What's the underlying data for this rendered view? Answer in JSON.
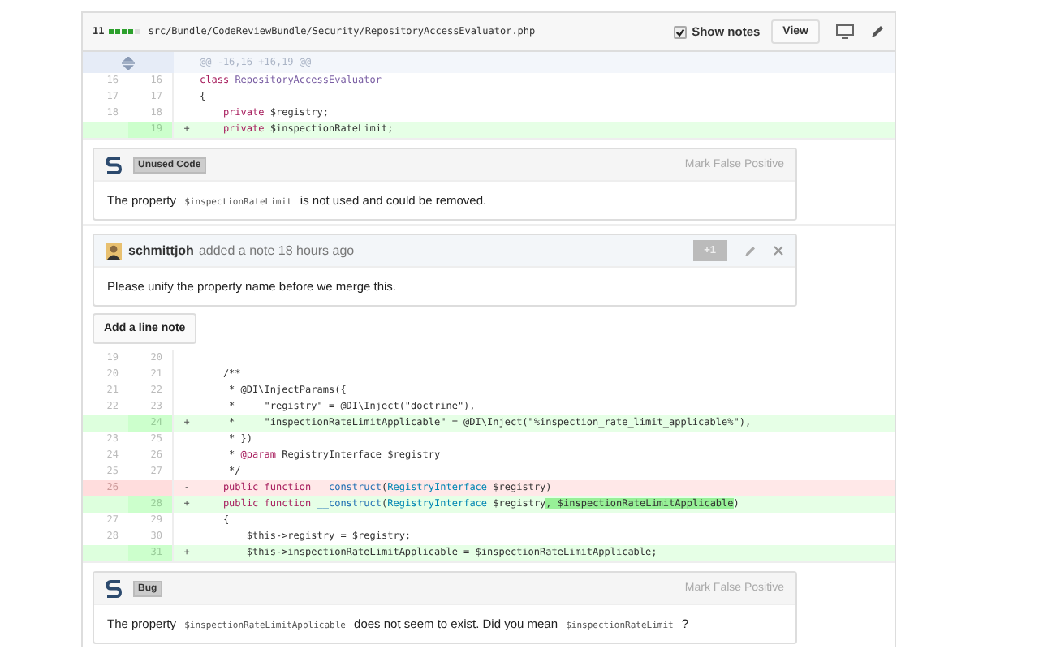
{
  "file": {
    "changes": "11",
    "diffstat": [
      true,
      true,
      true,
      true,
      false
    ],
    "path": "src/Bundle/CodeReviewBundle/Security/RepositoryAccessEvaluator.php",
    "show_notes": {
      "label": "Show notes",
      "checked": true
    },
    "view_button": "View"
  },
  "blocks": [
    {
      "kind": "hunk",
      "text": "@@ -16,16 +16,19 @@"
    },
    {
      "kind": "context",
      "old": "16",
      "new": "16",
      "code": [
        {
          "kind": "keyword",
          "text": "class "
        },
        {
          "kind": "class",
          "text": "RepositoryAccessEvaluator"
        }
      ]
    },
    {
      "kind": "context",
      "old": "17",
      "new": "17",
      "code": [
        {
          "kind": "plain",
          "text": "{"
        }
      ]
    },
    {
      "kind": "context",
      "old": "18",
      "new": "18",
      "code": [
        {
          "kind": "keyword",
          "text": "    private "
        },
        {
          "kind": "plain",
          "text": "$registry;"
        }
      ]
    },
    {
      "kind": "added",
      "new": "19",
      "sign": "+",
      "code": [
        {
          "kind": "keyword",
          "text": "    private "
        },
        {
          "kind": "plain",
          "text": "$inspectionRateLimit;"
        }
      ]
    },
    {
      "kind": "issue",
      "tag": "Unused Code",
      "action": "Mark False Positive",
      "message": [
        {
          "kind": "text",
          "text": "The property "
        },
        {
          "kind": "code",
          "text": "$inspectionRateLimit"
        },
        {
          "kind": "text",
          "text": " is not used and could be removed."
        }
      ]
    },
    {
      "kind": "note",
      "author": "schmittjoh",
      "meta": "added a note 18 hours ago",
      "vote": "+1",
      "body": "Please unify the property name before we merge this."
    },
    {
      "kind": "add-note",
      "label": "Add a line note"
    },
    {
      "kind": "context",
      "old": "19",
      "new": "20"
    },
    {
      "kind": "context",
      "old": "20",
      "new": "21",
      "code": [
        {
          "kind": "plain",
          "text": "    /**"
        }
      ]
    },
    {
      "kind": "context",
      "old": "21",
      "new": "22",
      "code": [
        {
          "kind": "plain",
          "text": "     * @DI\\InjectParams({"
        }
      ]
    },
    {
      "kind": "context",
      "old": "22",
      "new": "23",
      "code": [
        {
          "kind": "plain",
          "text": "     *     \"registry\" = @DI\\Inject(\"doctrine\"),"
        }
      ]
    },
    {
      "kind": "added",
      "new": "24",
      "sign": "+",
      "code": [
        {
          "kind": "plain",
          "text": "     *     \"inspectionRateLimitApplicable\" = @DI\\Inject(\"%inspection_rate_limit_applicable%\"),"
        }
      ]
    },
    {
      "kind": "context",
      "old": "23",
      "new": "25",
      "code": [
        {
          "kind": "plain",
          "text": "     * })"
        }
      ]
    },
    {
      "kind": "context",
      "old": "24",
      "new": "26",
      "code": [
        {
          "kind": "plain",
          "text": "     * "
        },
        {
          "kind": "keyword",
          "text": "@param"
        },
        {
          "kind": "plain",
          "text": " RegistryInterface $registry"
        }
      ]
    },
    {
      "kind": "context",
      "old": "25",
      "new": "27",
      "code": [
        {
          "kind": "plain",
          "text": "     */"
        }
      ]
    },
    {
      "kind": "removed",
      "old": "26",
      "sign": "-",
      "code": [
        {
          "kind": "keyword",
          "text": "    public function "
        },
        {
          "kind": "function",
          "text": "__construct"
        },
        {
          "kind": "plain",
          "text": "("
        },
        {
          "kind": "type",
          "text": "RegistryInterface"
        },
        {
          "kind": "plain",
          "text": " $registry)"
        }
      ]
    },
    {
      "kind": "added",
      "new": "28",
      "sign": "+",
      "code": [
        {
          "kind": "keyword",
          "text": "    public function "
        },
        {
          "kind": "function",
          "text": "__construct"
        },
        {
          "kind": "plain",
          "text": "("
        },
        {
          "kind": "type",
          "text": "RegistryInterface"
        },
        {
          "kind": "plain",
          "text": " $registry"
        },
        {
          "kind": "highlight",
          "text": ", $inspectionRateLimitApplicable"
        },
        {
          "kind": "plain",
          "text": ")"
        }
      ]
    },
    {
      "kind": "context",
      "old": "27",
      "new": "29",
      "code": [
        {
          "kind": "plain",
          "text": "    {"
        }
      ]
    },
    {
      "kind": "context",
      "old": "28",
      "new": "30",
      "code": [
        {
          "kind": "plain",
          "text": "        $this->registry = $registry;"
        }
      ]
    },
    {
      "kind": "added",
      "new": "31",
      "sign": "+",
      "code": [
        {
          "kind": "plain",
          "text": "        $this->inspectionRateLimitApplicable = $inspectionRateLimitApplicable;"
        }
      ]
    },
    {
      "kind": "issue",
      "tag": "Bug",
      "action": "Mark False Positive",
      "message": [
        {
          "kind": "text",
          "text": "The property "
        },
        {
          "kind": "code",
          "text": "$inspectionRateLimitApplicable"
        },
        {
          "kind": "text",
          "text": " does not seem to exist. Did you mean "
        },
        {
          "kind": "code",
          "text": "$inspectionRateLimit"
        },
        {
          "kind": "text",
          "text": " ?"
        }
      ]
    }
  ]
}
